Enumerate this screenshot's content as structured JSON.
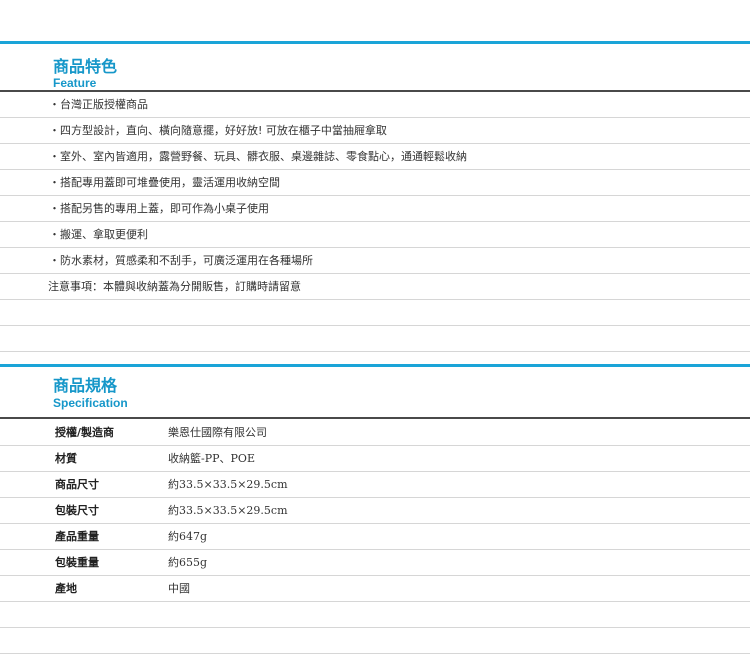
{
  "feature": {
    "title_zh": "商品特色",
    "title_en": "Feature",
    "items": [
      "・台灣正版授權商品",
      "・四方型設計，直向、橫向隨意擺，好好放! 可放在櫃子中當抽屜拿取",
      "・室外、室內皆適用，露營野餐、玩具、髒衣服、桌邊雜誌、零食點心，通通輕鬆收納",
      "・搭配專用蓋即可堆疊使用，靈活運用收納空間",
      "・搭配另售的專用上蓋，即可作為小桌子使用",
      "・搬運、拿取更便利",
      "・防水素材，質感柔和不刮手，可廣泛運用在各種場所"
    ],
    "note": "注意事項：本體與收納蓋為分開販售，訂購時請留意"
  },
  "spec": {
    "title_zh": "商品規格",
    "title_en": "Specification",
    "rows": [
      {
        "label": "授權/製造商",
        "value": "樂恩仕國際有限公司"
      },
      {
        "label": "材質",
        "value": "收納籃-PP、POE"
      },
      {
        "label": "商品尺寸",
        "value": "約33.5×33.5×29.5cm"
      },
      {
        "label": "包裝尺寸",
        "value": "約33.5×33.5×29.5cm"
      },
      {
        "label": "產品重量",
        "value": "約647g"
      },
      {
        "label": "包裝重量",
        "value": "約655g"
      },
      {
        "label": "產地",
        "value": "中國"
      }
    ]
  },
  "colors": {
    "accent": "#1aa4d8",
    "heading": "#1697c9",
    "divider": "#4a4a4a",
    "row_border": "#d6d6d6"
  }
}
